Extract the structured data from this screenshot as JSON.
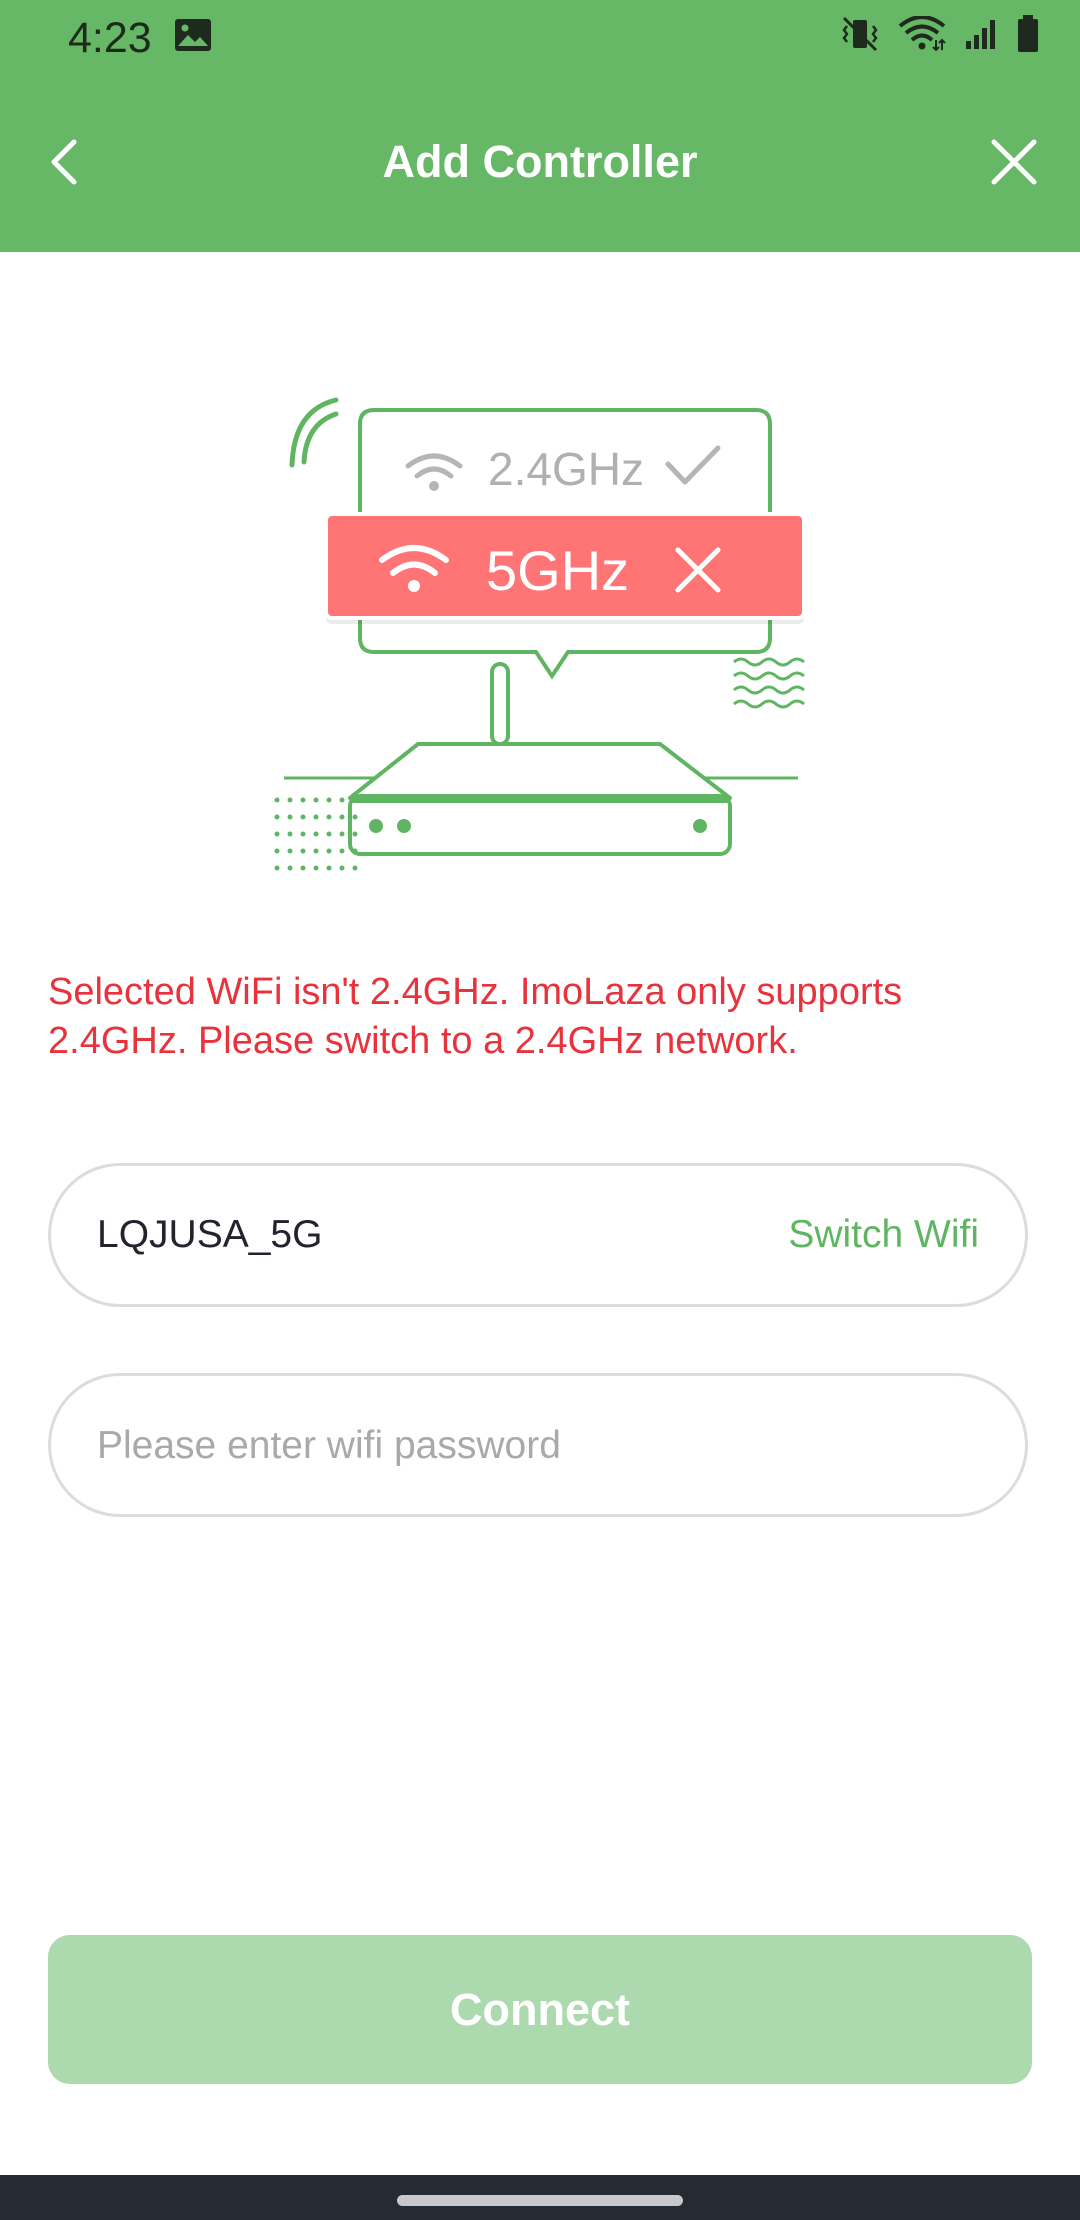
{
  "status_bar": {
    "time": "4:23",
    "icons": [
      "image-icon",
      "vibrate-mute-icon",
      "wifi-icon",
      "signal-icon",
      "battery-icon"
    ]
  },
  "header": {
    "title": "Add Controller",
    "back_icon": "chevron-left-icon",
    "close_icon": "close-icon"
  },
  "illustration": {
    "band_ok_label": "2.4GHz",
    "band_bad_label": "5GHz"
  },
  "error_message": "Selected WiFi isn't 2.4GHz. ImoLaza only supports 2.4GHz. Please switch to a 2.4GHz network.",
  "ssid_field": {
    "value": "LQJUSA_5G",
    "switch_label": "Switch Wifi"
  },
  "password_field": {
    "value": "",
    "placeholder": "Please enter wifi password"
  },
  "connect_button": {
    "label": "Connect",
    "enabled": false
  },
  "colors": {
    "brand_green": "#67b866",
    "error_red": "#e8333c",
    "band_bad_bg": "#ff7475",
    "connect_disabled": "#acd9ae"
  }
}
